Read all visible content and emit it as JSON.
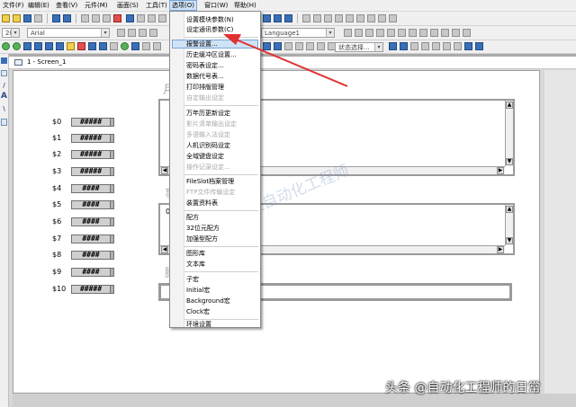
{
  "menubar": {
    "items": [
      "文件(F)",
      "编辑(E)",
      "查看(V)",
      "元件(M)",
      "画面(S)",
      "工具(T)",
      "选项(O)",
      "窗口(W)",
      "帮助(H)"
    ]
  },
  "toolbar": {
    "font_name": "Arial",
    "font_size": "20",
    "language": "Language1",
    "state_select": "状态选择..."
  },
  "screen": {
    "title": "1 - Screen_1"
  },
  "rows": [
    {
      "label": "$0",
      "value": "#####"
    },
    {
      "label": "$1",
      "value": "#####"
    },
    {
      "label": "$2",
      "value": "#####"
    },
    {
      "label": "$3",
      "value": "#####"
    },
    {
      "label": "$4",
      "value": "####"
    },
    {
      "label": "$5",
      "value": "####"
    },
    {
      "label": "$6",
      "value": "####"
    },
    {
      "label": "$7",
      "value": "####"
    },
    {
      "label": "$8",
      "value": "####"
    },
    {
      "label": "$9",
      "value": "####"
    },
    {
      "label": "$10",
      "value": "#####"
    }
  ],
  "panels": {
    "panel1_label": "月",
    "panel2_label": "事",
    "panel2_first": "0",
    "panel3_label": "脚"
  },
  "options_menu": {
    "items": [
      {
        "label": "设置模块参数(N)",
        "enabled": true
      },
      {
        "label": "设定通讯参数(C)",
        "enabled": true
      },
      {
        "label": "报警设置...",
        "enabled": true,
        "highlighted": true
      },
      {
        "label": "历史缓冲区设置...",
        "enabled": true
      },
      {
        "label": "密码表设定...",
        "enabled": true
      },
      {
        "label": "数据代号表...",
        "enabled": true
      },
      {
        "label": "打印排版管理",
        "enabled": true
      },
      {
        "label": "自定输出设定",
        "enabled": false
      },
      {
        "label": "万年历更新设定",
        "enabled": true
      },
      {
        "label": "影片清单输出设定",
        "enabled": false
      },
      {
        "label": "多语输入法设定",
        "enabled": false
      },
      {
        "label": "人机识别码设定",
        "enabled": true
      },
      {
        "label": "全域键盘设定",
        "enabled": true
      },
      {
        "label": "操作记录设定...",
        "enabled": false
      },
      {
        "label": "FileSlot档案管理",
        "enabled": true
      },
      {
        "label": "FTP文件传输设定",
        "enabled": false
      },
      {
        "label": "装置资料表",
        "enabled": true
      },
      {
        "label": "配方",
        "enabled": true
      },
      {
        "label": "32位元配方",
        "enabled": true
      },
      {
        "label": "加强型配方",
        "enabled": true
      },
      {
        "label": "图形库",
        "enabled": true
      },
      {
        "label": "文本库",
        "enabled": true
      },
      {
        "label": "子宏",
        "enabled": true
      },
      {
        "label": "Initial宏",
        "enabled": true
      },
      {
        "label": "Background宏",
        "enabled": true
      },
      {
        "label": "Clock宏",
        "enabled": true
      },
      {
        "label": "环境设置",
        "enabled": true
      }
    ]
  },
  "watermark": "函控自动化工程师",
  "credit": "头条 @自动化工程师的日常",
  "colors": {
    "highlight": "#cfe2f6",
    "arrow": "#e03030"
  }
}
